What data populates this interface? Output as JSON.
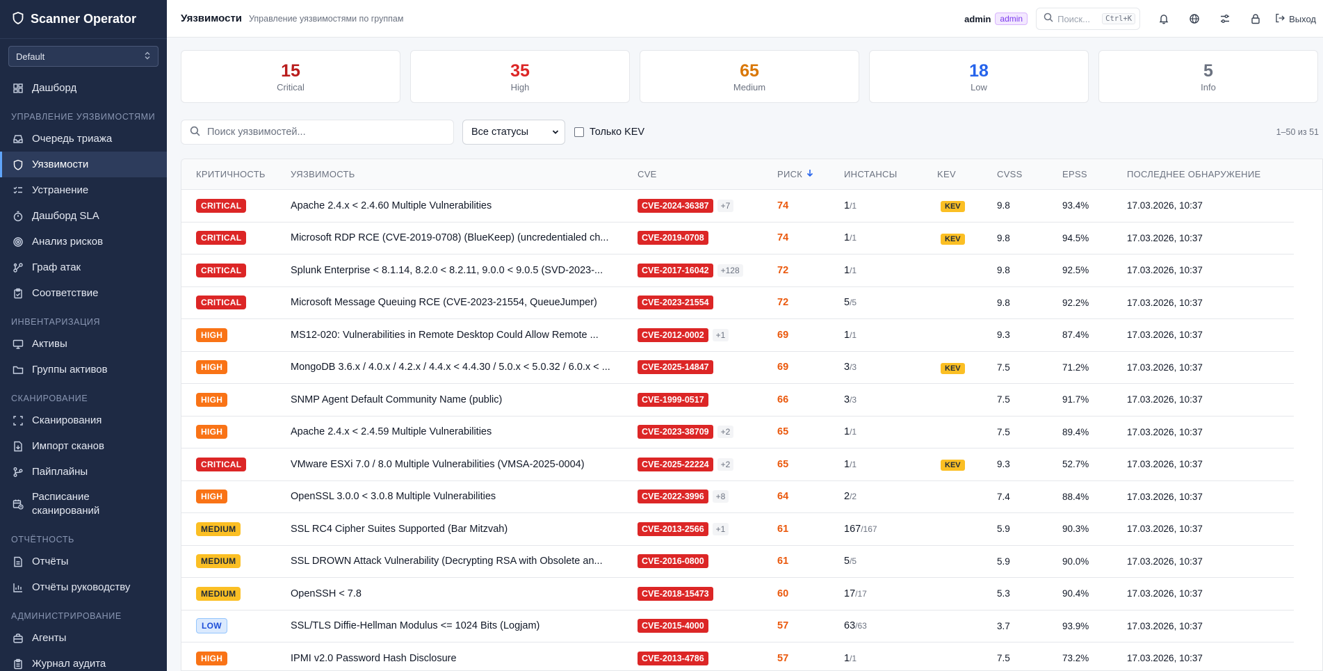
{
  "app": {
    "name": "Scanner Operator",
    "workspace": "Default"
  },
  "sidebar": {
    "items": [
      {
        "type": "item",
        "label": "Дашборд",
        "icon": "dashboard-icon"
      },
      {
        "type": "section",
        "label": "УПРАВЛЕНИЕ УЯЗВИМОСТЯМИ"
      },
      {
        "type": "item",
        "label": "Очередь триажа",
        "icon": "inbox-icon"
      },
      {
        "type": "item",
        "label": "Уязвимости",
        "icon": "shield-icon",
        "active": true
      },
      {
        "type": "item",
        "label": "Устранение",
        "icon": "list-check-icon"
      },
      {
        "type": "item",
        "label": "Дашборд SLA",
        "icon": "timer-icon"
      },
      {
        "type": "item",
        "label": "Анализ рисков",
        "icon": "target-icon"
      },
      {
        "type": "item",
        "label": "Граф атак",
        "icon": "graph-icon"
      },
      {
        "type": "item",
        "label": "Соответствие",
        "icon": "clipboard-check-icon"
      },
      {
        "type": "section",
        "label": "ИНВЕНТАРИЗАЦИЯ"
      },
      {
        "type": "item",
        "label": "Активы",
        "icon": "monitor-icon"
      },
      {
        "type": "item",
        "label": "Группы активов",
        "icon": "folder-icon"
      },
      {
        "type": "section",
        "label": "СКАНИРОВАНИЕ"
      },
      {
        "type": "item",
        "label": "Сканирования",
        "icon": "scan-icon"
      },
      {
        "type": "item",
        "label": "Импорт сканов",
        "icon": "file-import-icon"
      },
      {
        "type": "item",
        "label": "Пайплайны",
        "icon": "pipeline-icon"
      },
      {
        "type": "item",
        "label": "Расписание сканирований",
        "icon": "calendar-clock-icon",
        "tall": true
      },
      {
        "type": "section",
        "label": "ОТЧЁТНОСТЬ"
      },
      {
        "type": "item",
        "label": "Отчёты",
        "icon": "file-text-icon"
      },
      {
        "type": "item",
        "label": "Отчёты руководству",
        "icon": "bar-chart-icon"
      },
      {
        "type": "section",
        "label": "АДМИНИСТРИРОВАНИЕ"
      },
      {
        "type": "item",
        "label": "Агенты",
        "icon": "agent-icon"
      },
      {
        "type": "item",
        "label": "Журнал аудита",
        "icon": "clipboard-icon"
      }
    ]
  },
  "header": {
    "title": "Уязвимости",
    "subtitle": "Управление уязвимостями по группам",
    "user": "admin",
    "role": "admin",
    "search_placeholder": "Поиск...",
    "search_shortcut": "Ctrl+K",
    "logout_label": "Выход"
  },
  "summary": [
    {
      "count": "15",
      "label": "Critical",
      "color": "#b91c1c"
    },
    {
      "count": "35",
      "label": "High",
      "color": "#dc2626"
    },
    {
      "count": "65",
      "label": "Medium",
      "color": "#d97706"
    },
    {
      "count": "18",
      "label": "Low",
      "color": "#2563eb"
    },
    {
      "count": "5",
      "label": "Info",
      "color": "#6b7280"
    }
  ],
  "filters": {
    "search_placeholder": "Поиск уязвимостей...",
    "status_value": "Все статусы",
    "kev_only_label": "Только KEV",
    "kev_only_checked": false,
    "count_text": "1–50 из 51"
  },
  "table": {
    "columns": {
      "severity": "КРИТИЧНОСТЬ",
      "name": "УЯЗВИМОСТЬ",
      "cve": "CVE",
      "risk": "РИСК",
      "instances": "ИНСТАНСЫ",
      "kev": "KEV",
      "cvss": "CVSS",
      "epss": "EPSS",
      "last_seen": "ПОСЛЕДНЕЕ ОБНАРУЖЕНИЕ"
    },
    "sort": {
      "column": "risk",
      "direction": "desc"
    },
    "rows": [
      {
        "severity": "CRITICAL",
        "name": "Apache 2.4.x < 2.4.60 Multiple Vulnerabilities",
        "cve": "CVE-2024-36387",
        "more": "+7",
        "risk": "74",
        "inst": "1",
        "inst_total": "/1",
        "kev": "KEV",
        "cvss": "9.8",
        "epss": "93.4%",
        "last": "17.03.2026, 10:37"
      },
      {
        "severity": "CRITICAL",
        "name": "Microsoft RDP RCE (CVE-2019-0708) (BlueKeep) (uncredentialed ch...",
        "cve": "CVE-2019-0708",
        "more": "",
        "risk": "74",
        "inst": "1",
        "inst_total": "/1",
        "kev": "KEV",
        "cvss": "9.8",
        "epss": "94.5%",
        "last": "17.03.2026, 10:37"
      },
      {
        "severity": "CRITICAL",
        "name": "Splunk Enterprise < 8.1.14, 8.2.0 < 8.2.11, 9.0.0 < 9.0.5 (SVD-2023-...",
        "cve": "CVE-2017-16042",
        "more": "+128",
        "risk": "72",
        "inst": "1",
        "inst_total": "/1",
        "kev": "",
        "cvss": "9.8",
        "epss": "92.5%",
        "last": "17.03.2026, 10:37"
      },
      {
        "severity": "CRITICAL",
        "name": "Microsoft Message Queuing RCE (CVE-2023-21554, QueueJumper)",
        "cve": "CVE-2023-21554",
        "more": "",
        "risk": "72",
        "inst": "5",
        "inst_total": "/5",
        "kev": "",
        "cvss": "9.8",
        "epss": "92.2%",
        "last": "17.03.2026, 10:37"
      },
      {
        "severity": "HIGH",
        "name": "MS12-020: Vulnerabilities in Remote Desktop Could Allow Remote ...",
        "cve": "CVE-2012-0002",
        "more": "+1",
        "risk": "69",
        "inst": "1",
        "inst_total": "/1",
        "kev": "",
        "cvss": "9.3",
        "epss": "87.4%",
        "last": "17.03.2026, 10:37"
      },
      {
        "severity": "HIGH",
        "name": "MongoDB 3.6.x / 4.0.x / 4.2.x / 4.4.x < 4.4.30 / 5.0.x < 5.0.32 / 6.0.x < ...",
        "cve": "CVE-2025-14847",
        "more": "",
        "risk": "69",
        "inst": "3",
        "inst_total": "/3",
        "kev": "KEV",
        "cvss": "7.5",
        "epss": "71.2%",
        "last": "17.03.2026, 10:37"
      },
      {
        "severity": "HIGH",
        "name": "SNMP Agent Default Community Name (public)",
        "cve": "CVE-1999-0517",
        "more": "",
        "risk": "66",
        "inst": "3",
        "inst_total": "/3",
        "kev": "",
        "cvss": "7.5",
        "epss": "91.7%",
        "last": "17.03.2026, 10:37"
      },
      {
        "severity": "HIGH",
        "name": "Apache 2.4.x < 2.4.59 Multiple Vulnerabilities",
        "cve": "CVE-2023-38709",
        "more": "+2",
        "risk": "65",
        "inst": "1",
        "inst_total": "/1",
        "kev": "",
        "cvss": "7.5",
        "epss": "89.4%",
        "last": "17.03.2026, 10:37"
      },
      {
        "severity": "CRITICAL",
        "name": "VMware ESXi 7.0 / 8.0 Multiple Vulnerabilities (VMSA-2025-0004)",
        "cve": "CVE-2025-22224",
        "more": "+2",
        "risk": "65",
        "inst": "1",
        "inst_total": "/1",
        "kev": "KEV",
        "cvss": "9.3",
        "epss": "52.7%",
        "last": "17.03.2026, 10:37"
      },
      {
        "severity": "HIGH",
        "name": "OpenSSL 3.0.0 < 3.0.8 Multiple Vulnerabilities",
        "cve": "CVE-2022-3996",
        "more": "+8",
        "risk": "64",
        "inst": "2",
        "inst_total": "/2",
        "kev": "",
        "cvss": "7.4",
        "epss": "88.4%",
        "last": "17.03.2026, 10:37"
      },
      {
        "severity": "MEDIUM",
        "name": "SSL RC4 Cipher Suites Supported (Bar Mitzvah)",
        "cve": "CVE-2013-2566",
        "more": "+1",
        "risk": "61",
        "inst": "167",
        "inst_total": "/167",
        "kev": "",
        "cvss": "5.9",
        "epss": "90.3%",
        "last": "17.03.2026, 10:37"
      },
      {
        "severity": "MEDIUM",
        "name": "SSL DROWN Attack Vulnerability (Decrypting RSA with Obsolete an...",
        "cve": "CVE-2016-0800",
        "more": "",
        "risk": "61",
        "inst": "5",
        "inst_total": "/5",
        "kev": "",
        "cvss": "5.9",
        "epss": "90.0%",
        "last": "17.03.2026, 10:37"
      },
      {
        "severity": "MEDIUM",
        "name": "OpenSSH < 7.8",
        "cve": "CVE-2018-15473",
        "more": "",
        "risk": "60",
        "inst": "17",
        "inst_total": "/17",
        "kev": "",
        "cvss": "5.3",
        "epss": "90.4%",
        "last": "17.03.2026, 10:37"
      },
      {
        "severity": "LOW",
        "name": "SSL/TLS Diffie-Hellman Modulus <= 1024 Bits (Logjam)",
        "cve": "CVE-2015-4000",
        "more": "",
        "risk": "57",
        "inst": "63",
        "inst_total": "/63",
        "kev": "",
        "cvss": "3.7",
        "epss": "93.9%",
        "last": "17.03.2026, 10:37"
      },
      {
        "severity": "HIGH",
        "name": "IPMI v2.0 Password Hash Disclosure",
        "cve": "CVE-2013-4786",
        "more": "",
        "risk": "57",
        "inst": "1",
        "inst_total": "/1",
        "kev": "",
        "cvss": "7.5",
        "epss": "73.2%",
        "last": "17.03.2026, 10:37"
      }
    ]
  }
}
